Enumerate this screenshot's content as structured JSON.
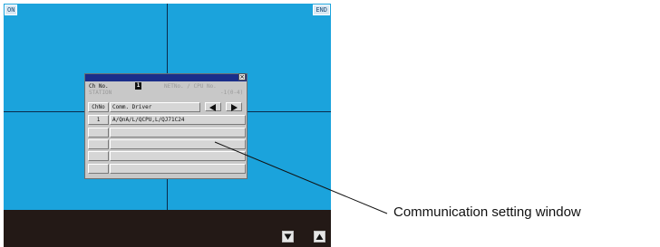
{
  "screen": {
    "corner_left": "ON",
    "corner_right": "END",
    "scroll_down_icon": "down-triangle",
    "scroll_up_icon": "up-triangle"
  },
  "dialog": {
    "close_label": "×",
    "ch_no_label": "Ch No.",
    "ch_no_value": "1",
    "station_label": "STATION",
    "station_value": "",
    "net_cpu_label": "NETNo. / CPU No.",
    "net_value": "",
    "cpu_value": "-1(0-4)",
    "col_chno": "ChNo",
    "col_driver": "Comm. Driver",
    "rows": [
      {
        "chno": "1",
        "driver": "A/QnA/L/QCPU,L/QJ71C24"
      },
      {
        "chno": "",
        "driver": ""
      },
      {
        "chno": "",
        "driver": ""
      },
      {
        "chno": "",
        "driver": ""
      },
      {
        "chno": "",
        "driver": ""
      }
    ]
  },
  "callout": {
    "text": "Communication setting window"
  },
  "colors": {
    "screen_bg": "#1ba3dc",
    "bottom_bar": "#231916",
    "titlebar": "#1a2e8a"
  }
}
